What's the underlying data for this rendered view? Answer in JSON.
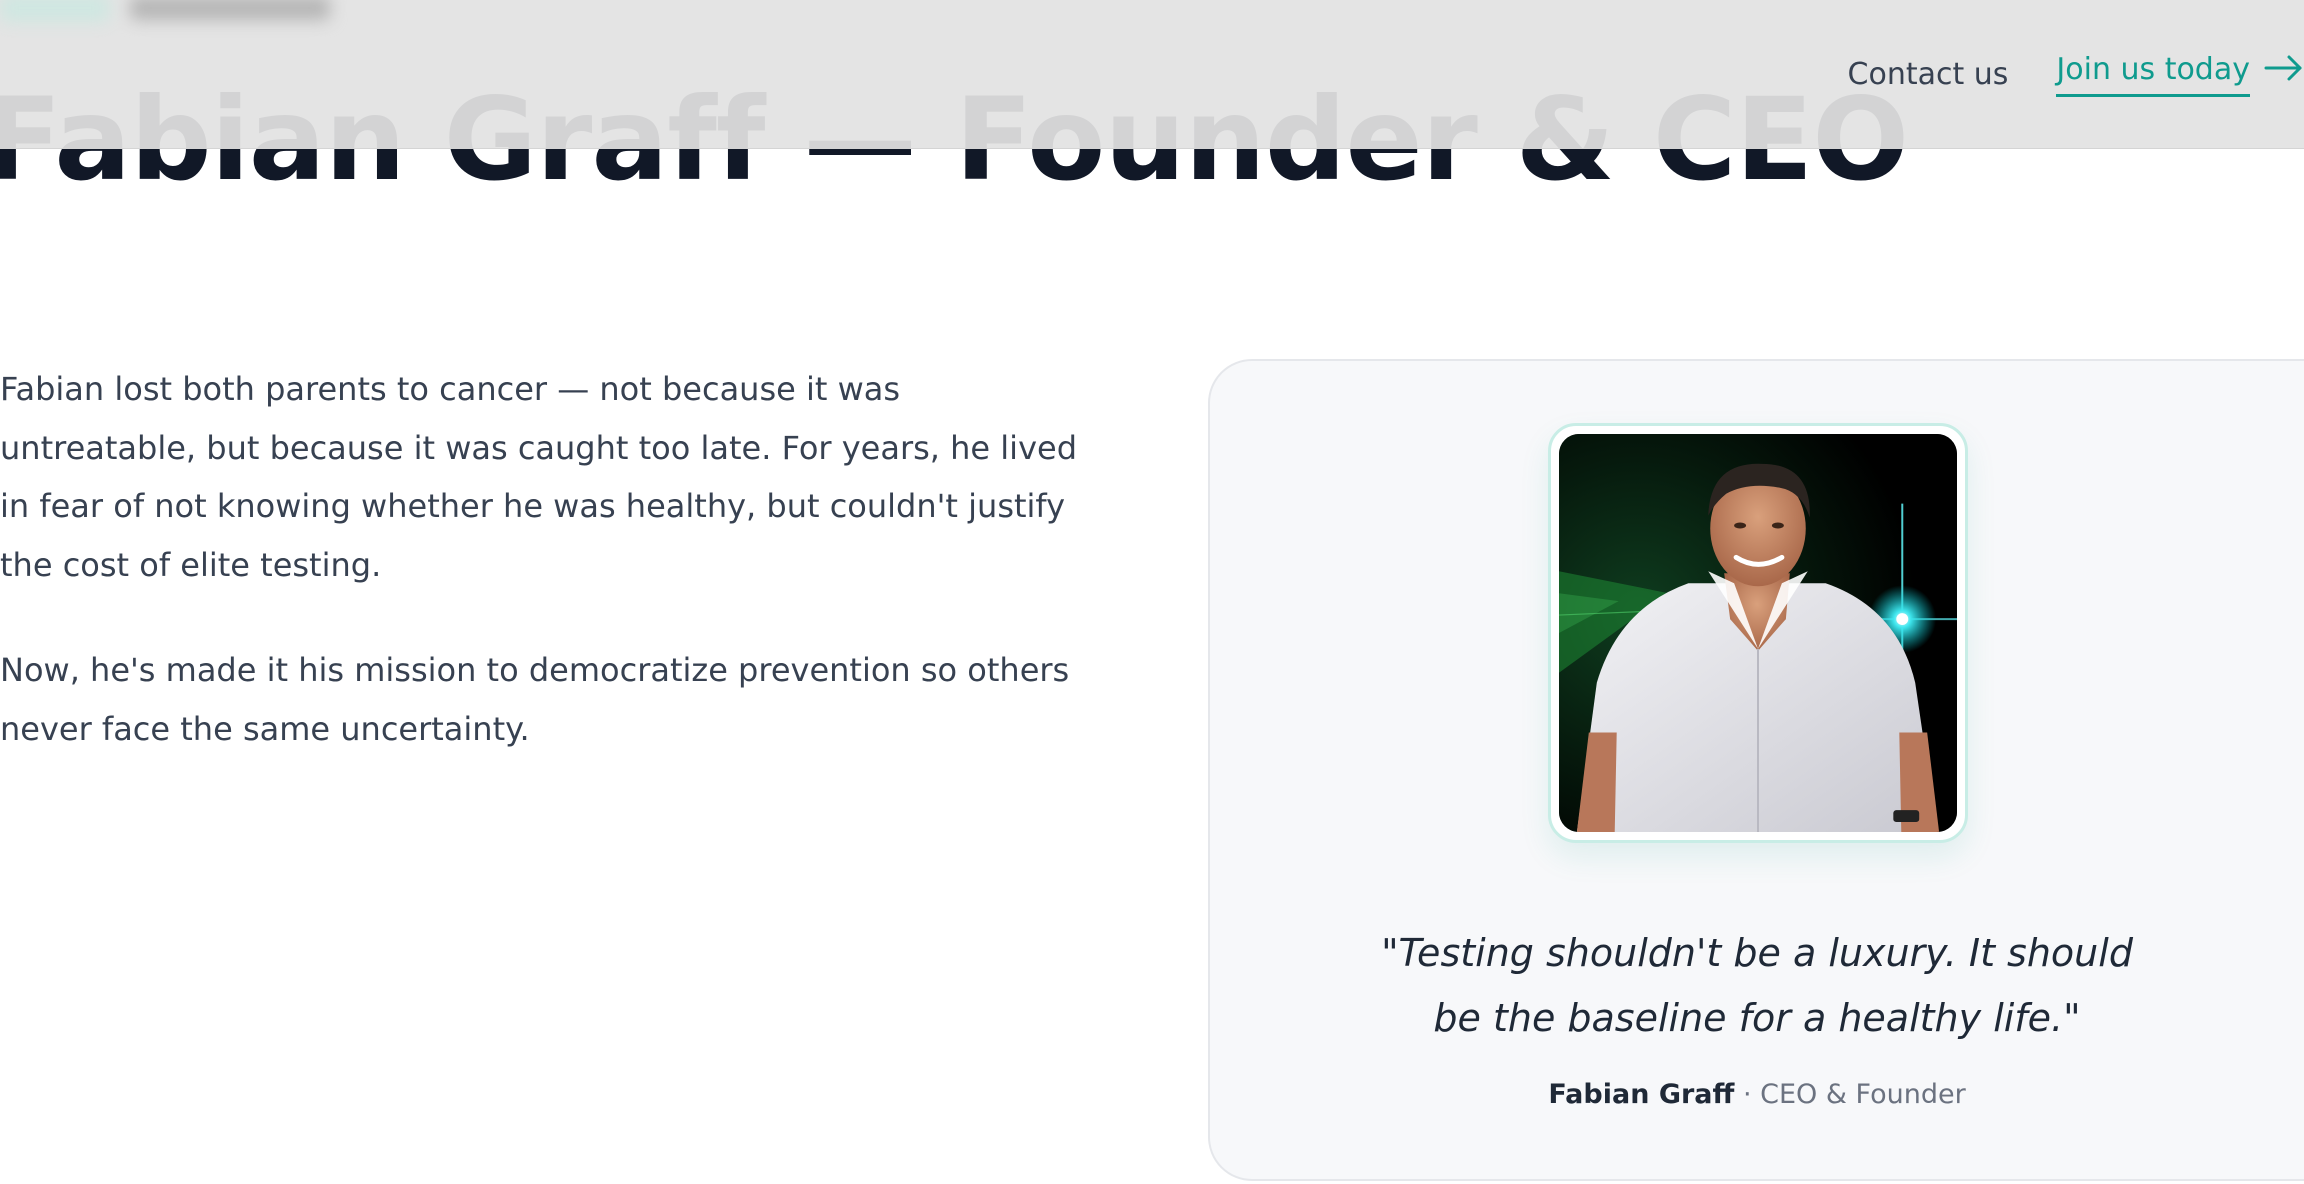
{
  "header": {
    "nav": {
      "contact_label": "Contact us",
      "join_label": "Join us today",
      "join_icon": "arrow-right-icon"
    },
    "accent_color": "#0f9b8e"
  },
  "hero": {
    "title": "Fabian Graff — Founder & CEO"
  },
  "story": {
    "paragraphs": [
      "Fabian lost both parents to cancer — not because it was untreatable, but because it was caught too late. For years, he lived in fear of not knowing whether he was healthy, but couldn't justify the cost of elite testing.",
      "Now, he's made it his mission to democratize prevention so others never face the same uncertainty."
    ]
  },
  "founder_card": {
    "quote": "\"Testing shouldn't be a luxury. It should be the baseline for a healthy life.\"",
    "name": "Fabian Graff",
    "separator": " · ",
    "role": "CEO & Founder"
  }
}
